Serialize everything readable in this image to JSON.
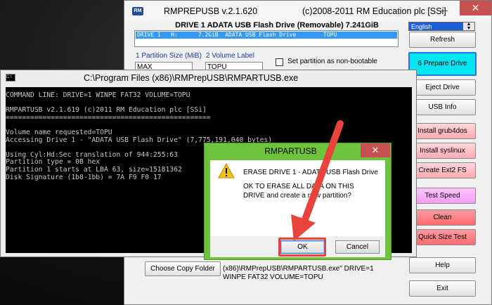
{
  "main_window": {
    "title": "RMPREPUSB v.2.1.620",
    "copyright": "(c)2008-2011 RM Education plc [SSi]",
    "drive_header": "DRIVE 1  ADATA USB Flash Drive  (Removable) 7.241GiB",
    "drive_row": "DRIVE 1   H:      7.2GiB  ADATA USB Flash Drive        TOPU",
    "partition_size_label": "1 Partition Size (MiB)",
    "partition_size_value": "MAX",
    "volume_label_label": "2 Volume Label",
    "volume_label_value": "TOPU",
    "nonbootable_label": "Set partition as non-bootable",
    "language": "English",
    "buttons": {
      "refresh": "Refresh",
      "prepare": "6 Prepare Drive",
      "eject": "Eject Drive",
      "usb_info": "USB Info",
      "grub4dos": "Install grub4dos",
      "syslinux": "Install syslinux",
      "ext2": "Create Ext2 FS",
      "test_speed": "Test Speed",
      "clean": "Clean",
      "quick_size": "Quick Size Test",
      "help": "Help",
      "exit": "Exit",
      "choose_copy": "Choose Copy Folder"
    },
    "command_preview": "(x86)\\RMPrepUSB\\RMPARTUSB.exe\" DRIVE=1 WINPE FAT32 VOLUME=TOPU"
  },
  "console": {
    "title": "C:\\Program Files (x86)\\RMPrepUSB\\RMPARTUSB.exe",
    "lines": [
      "COMMAND LINE: DRIVE=1 WINPE FAT32 VOLUME=TOPU",
      "",
      "RMPARTUSB v2.1.619 (c)2011 RM Education plc [SSi]",
      "==================================================",
      "",
      "Volume name requested=TOPU",
      "Accessing Drive 1 - \"ADATA USB Flash Drive\" (7,775,191,040 bytes)",
      "",
      "Using Cyl:Hd:Sec translation of 944:255:63",
      "Partition type = 0B hex",
      "Partition 1 starts at LBA 63, size=15181362",
      "Disk Signature (1b8-1bb) = 7A F9 F0 17"
    ]
  },
  "dialog": {
    "title": "RMPARTUSB",
    "heading": "ERASE DRIVE 1  - ADATA USB Flash Drive",
    "message": "OK TO ERASE ALL DATA ON THIS DRIVE and create a new partition?",
    "ok_label": "OK",
    "cancel_label": "Cancel"
  },
  "colors": {
    "dialog_frame": "#6ec23c",
    "annotation": "#e8443c",
    "prepare_button": "#00e6f0"
  }
}
